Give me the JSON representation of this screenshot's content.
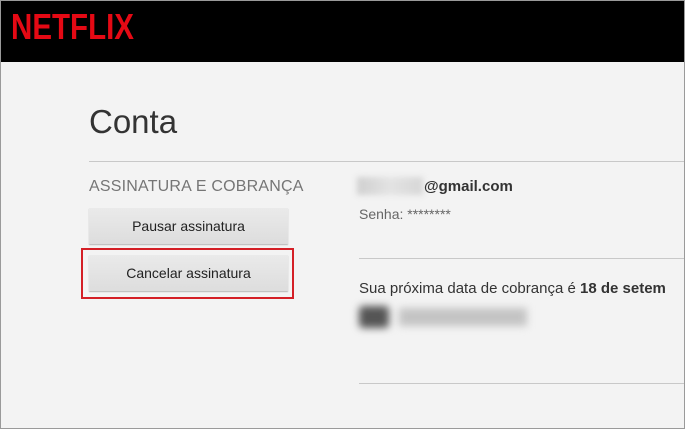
{
  "header": {
    "logo_text": "NETFLIX",
    "logo_color": "#e50914"
  },
  "page": {
    "title": "Conta"
  },
  "membership": {
    "section_label": "ASSINATURA E COBRANÇA",
    "pause_label": "Pausar assinatura",
    "cancel_label": "Cancelar assinatura",
    "email_suffix": "@gmail.com",
    "password_label": "Senha: ********",
    "billing_prefix": "Sua próxima data de cobrança é ",
    "billing_date": "18 de setem"
  },
  "annotation": {
    "highlight_color": "#d41f26"
  }
}
